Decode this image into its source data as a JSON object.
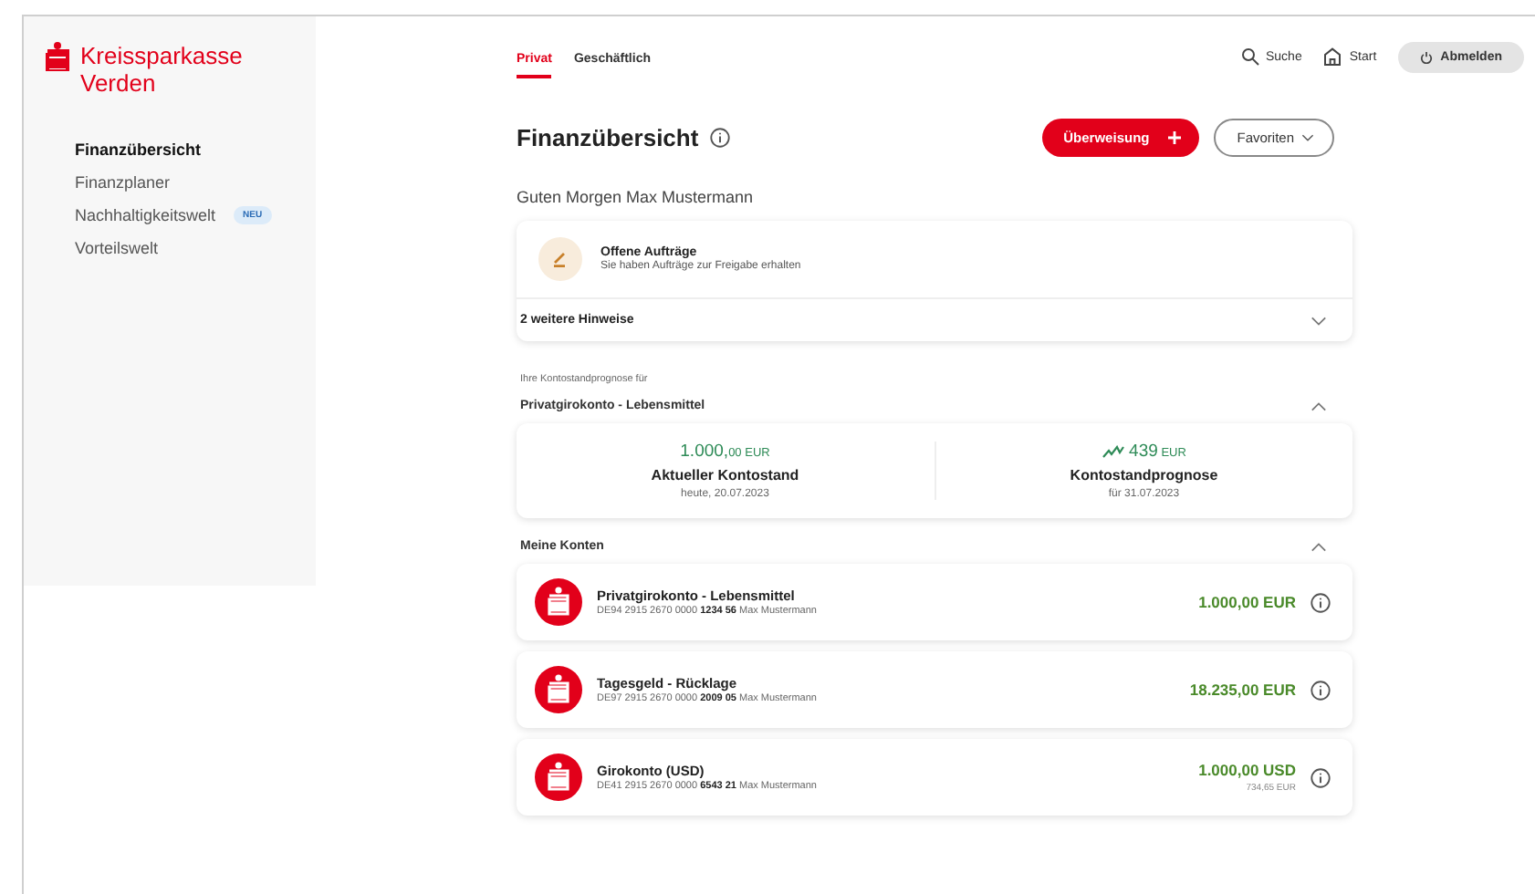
{
  "brand": {
    "name": "Kreissparkasse Verden"
  },
  "sidebar": {
    "items": [
      {
        "label": "Finanzübersicht",
        "selected": true
      },
      {
        "label": "Finanzplaner",
        "selected": false
      },
      {
        "label": "Nachhaltigkeitswelt",
        "selected": false,
        "badge": "NEU"
      },
      {
        "label": "Vorteilswelt",
        "selected": false
      }
    ]
  },
  "tabs": [
    {
      "label": "Privat",
      "selected": true
    },
    {
      "label": "Geschäftlich",
      "selected": false
    }
  ],
  "header_actions": [
    {
      "kind": "search",
      "label": "Suche"
    },
    {
      "kind": "home",
      "label": "Start"
    },
    {
      "kind": "logout",
      "label": "Abmelden"
    }
  ],
  "page": {
    "title": "Finanzübersicht",
    "primary_button": "Überweisung",
    "secondary_button": "Favoriten",
    "greeting": "Guten Morgen Max Mustermann"
  },
  "notice": {
    "title": "Offene Aufträge",
    "text": "Sie haben Aufträge zur Freigabe erhalten",
    "more": "2 weitere Hinweise",
    "expanded": false
  },
  "forecast": {
    "intro": "Ihre Kontostandprognose für",
    "account": "Privatgirokonto - Lebensmittel",
    "expanded": true,
    "items": [
      {
        "kind": "balance",
        "amount": "1.000,",
        "cents": "00",
        "currency": "EUR",
        "label": "Aktueller Kontostand",
        "date": "heute, 20.07.2023"
      },
      {
        "kind": "trend",
        "amount": "439",
        "currency": "EUR",
        "label": "Kontostandprognose",
        "date": "für 31.07.2023"
      }
    ]
  },
  "accounts": {
    "title": "Meine Konten",
    "expanded": true,
    "items": [
      {
        "name": "Privatgirokonto - Lebensmittel",
        "iban": "DE94 2915 2670 0000 **1234 56** Max Mustermann",
        "balance": "1.000,00 EUR"
      },
      {
        "name": "Tagesgeld - Rücklage",
        "iban": "DE97 2915 2670 0000 **2009 05** Max Mustermann",
        "balance": "18.235,00 EUR"
      },
      {
        "name": "Girokonto (USD)",
        "iban": "DE41 2915 2670 0000 **6543 21** Max Mustermann",
        "balance": "1.000,00 USD",
        "converted": "734,65 EUR"
      }
    ]
  }
}
